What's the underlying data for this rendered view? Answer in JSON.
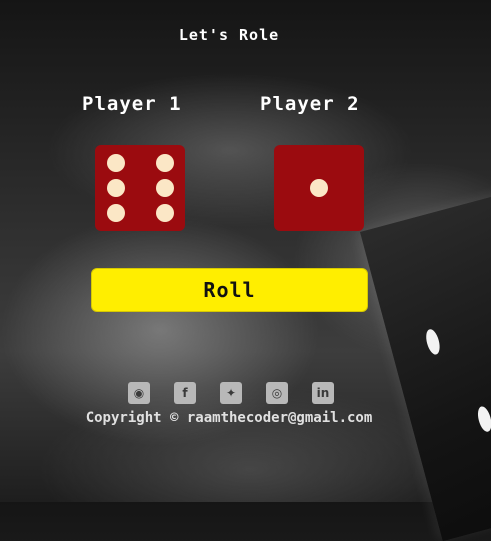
{
  "game": {
    "title": "Let's Role",
    "players": [
      {
        "label": "Player 1",
        "die_value": 6
      },
      {
        "label": "Player 2",
        "die_value": 1
      }
    ],
    "roll_label": "Roll"
  },
  "footer": {
    "social_icons": [
      "github-icon",
      "facebook-icon",
      "twitter-icon",
      "instagram-icon",
      "linkedin-icon"
    ],
    "copyright": "Copyright © raamthecoder@gmail.com"
  },
  "colors": {
    "die_face": "#9b0b0f",
    "pip": "#fbe7c6",
    "button": "#ffee00",
    "icon": "#b8b8b8"
  }
}
